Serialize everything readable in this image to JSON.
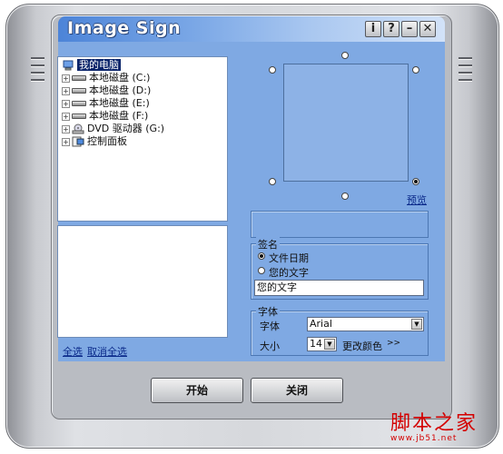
{
  "window": {
    "title": "Image Sign",
    "buttons": {
      "info": "i",
      "help": "?",
      "minimize": "–",
      "close": "✕"
    }
  },
  "tree": {
    "root": "我的电脑",
    "items": [
      {
        "label": "本地磁盘 (C:)",
        "icon": "drive-icon"
      },
      {
        "label": "本地磁盘 (D:)",
        "icon": "drive-icon"
      },
      {
        "label": "本地磁盘 (E:)",
        "icon": "drive-icon"
      },
      {
        "label": "本地磁盘 (F:)",
        "icon": "drive-icon"
      },
      {
        "label": "DVD 驱动器 (G:)",
        "icon": "dvd-drive-icon"
      },
      {
        "label": "控制面板",
        "icon": "control-panel-icon"
      }
    ]
  },
  "links": {
    "select_all": "全选",
    "deselect_all": "取消全选",
    "preview": "预览"
  },
  "signature": {
    "group_label": "签名",
    "option_file_date": "文件日期",
    "option_custom_text": "您的文字",
    "selected": "文件日期",
    "text_value": "您的文字"
  },
  "font": {
    "group_label": "字体",
    "family_label": "字体",
    "family_value": "Arial",
    "size_label": "大小",
    "size_value": "14",
    "change_color": "更改颜色",
    "more": ">>"
  },
  "footer": {
    "start": "开始",
    "close": "关闭"
  },
  "watermark": {
    "text": "脚本之家",
    "url": "www.jb51.net"
  },
  "colors": {
    "panel": "#7fa9e3",
    "title_gradient_start": "#4c84d8",
    "watermark": "#d40000"
  }
}
